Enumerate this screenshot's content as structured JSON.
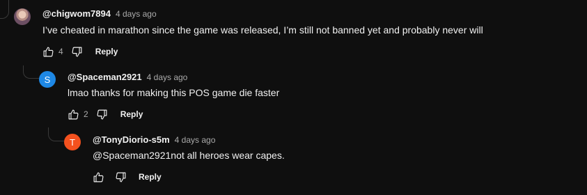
{
  "comments": [
    {
      "author": "@chigwom7894",
      "time": "4 days ago",
      "text": "I’ve cheated in marathon since the game was released, I’m still not banned yet and probably never will",
      "likes": "4",
      "reply_label": "Reply",
      "avatar_initial": "",
      "avatar_color": ""
    },
    {
      "author": "@Spaceman2921",
      "time": "4 days ago",
      "text": "lmao thanks for making this POS game die faster",
      "likes": "2",
      "reply_label": "Reply",
      "avatar_initial": "S",
      "avatar_color": "#1e88e5"
    },
    {
      "author": "@TonyDiorio-s5m",
      "time": "4 days ago",
      "text": "@Spaceman2921not all heroes wear capes.",
      "likes": "",
      "reply_label": "Reply",
      "avatar_initial": "T",
      "avatar_color": "#f4511e"
    }
  ],
  "icons": {
    "like": "thumbs-up-icon",
    "dislike": "thumbs-down-icon"
  }
}
